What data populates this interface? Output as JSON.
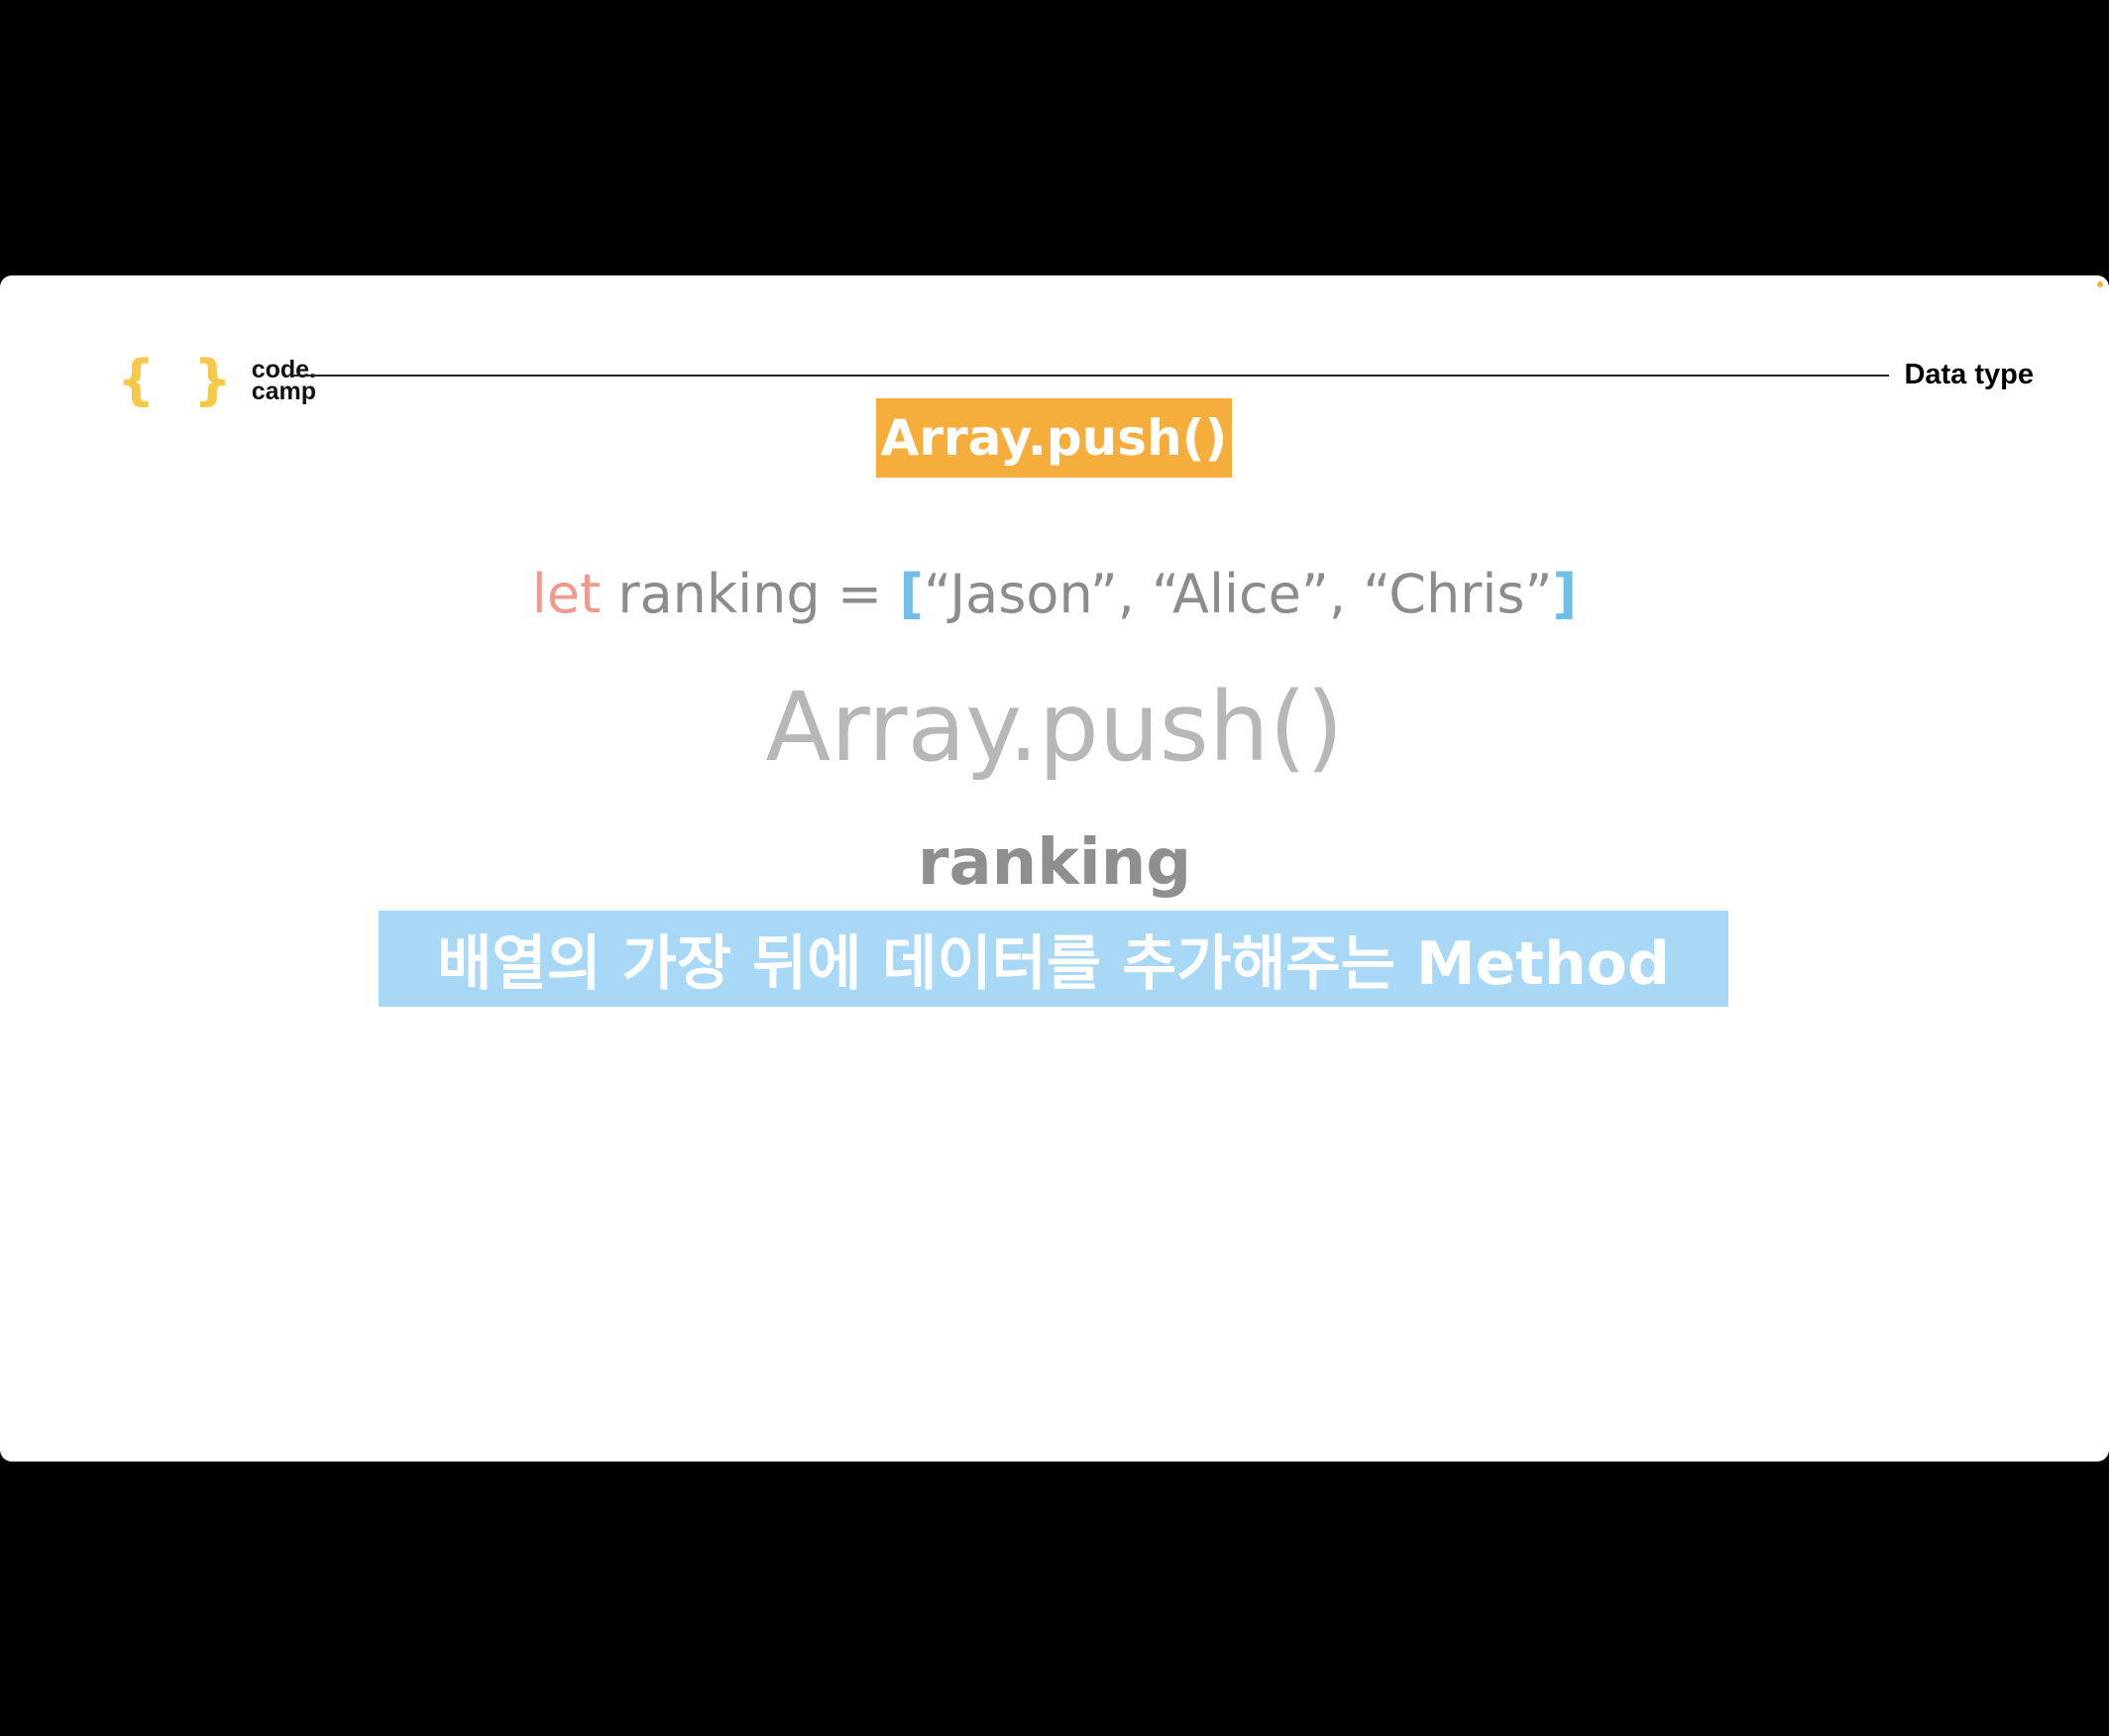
{
  "logo": {
    "braces": "{ }",
    "line1": "code.",
    "line2": "camp"
  },
  "header": {
    "section_label": "Data type"
  },
  "slide": {
    "title_badge": "Array.push()",
    "code": {
      "keyword": "let",
      "statement": " ranking = ",
      "open_bracket": "[",
      "items": "“Jason”, “Alice”, “Chris”",
      "close_bracket": "]"
    },
    "method_display": "Array.push()",
    "variable_name": "ranking",
    "caption": "배열의 가장 뒤에 데이터를 추가해주는 Method"
  },
  "colors": {
    "background": "#000000",
    "slide": "#ffffff",
    "accent_orange": "#f5ae3b",
    "accent_blue": "#a9d8f6",
    "keyword": "#ef9a90",
    "bracket": "#70bfe6",
    "logo_yellow": "#f7c948"
  }
}
